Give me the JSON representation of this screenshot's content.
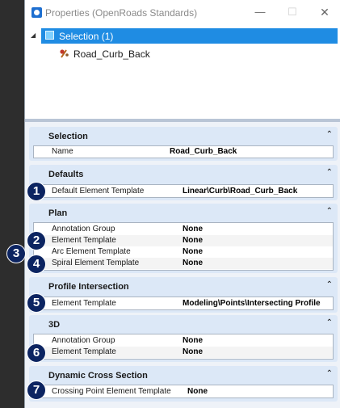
{
  "window": {
    "title": "Properties (OpenRoads Standards)",
    "minimize_glyph": "—",
    "maximize_glyph": "☐",
    "close_glyph": "✕"
  },
  "tree": {
    "expander_glyph": "◢",
    "selection_label": "Selection (1)",
    "child_label": "Road_Curb_Back"
  },
  "chevron_glyph": "⌃",
  "sections": {
    "selection": {
      "title": "Selection",
      "rows": [
        {
          "name": "Name",
          "value": "Road_Curb_Back"
        }
      ]
    },
    "defaults": {
      "title": "Defaults",
      "rows": [
        {
          "name": "Default Element Template",
          "value": "Linear\\Curb\\Road_Curb_Back"
        }
      ]
    },
    "plan": {
      "title": "Plan",
      "rows": [
        {
          "name": "Annotation Group",
          "value": "None"
        },
        {
          "name": "Element Template",
          "value": "None"
        },
        {
          "name": "Arc Element Template",
          "value": "None"
        },
        {
          "name": "Spiral Element Template",
          "value": "None"
        }
      ]
    },
    "profile": {
      "title": "Profile Intersection",
      "rows": [
        {
          "name": "Element Template",
          "value": "Modeling\\Points\\Intersecting Profile"
        }
      ]
    },
    "threed": {
      "title": "3D",
      "rows": [
        {
          "name": "Annotation Group",
          "value": "None"
        },
        {
          "name": "Element Template",
          "value": "None"
        }
      ]
    },
    "dynamic": {
      "title": "Dynamic Cross Section",
      "rows": [
        {
          "name": "Crossing Point Element Template",
          "value": "None"
        }
      ]
    }
  },
  "callouts": [
    "1",
    "2",
    "3",
    "4",
    "5",
    "6",
    "7"
  ],
  "colors": {
    "selection_highlight": "#1f8ce3",
    "section_header": "#dce8f7",
    "callout": "#0c2461"
  }
}
